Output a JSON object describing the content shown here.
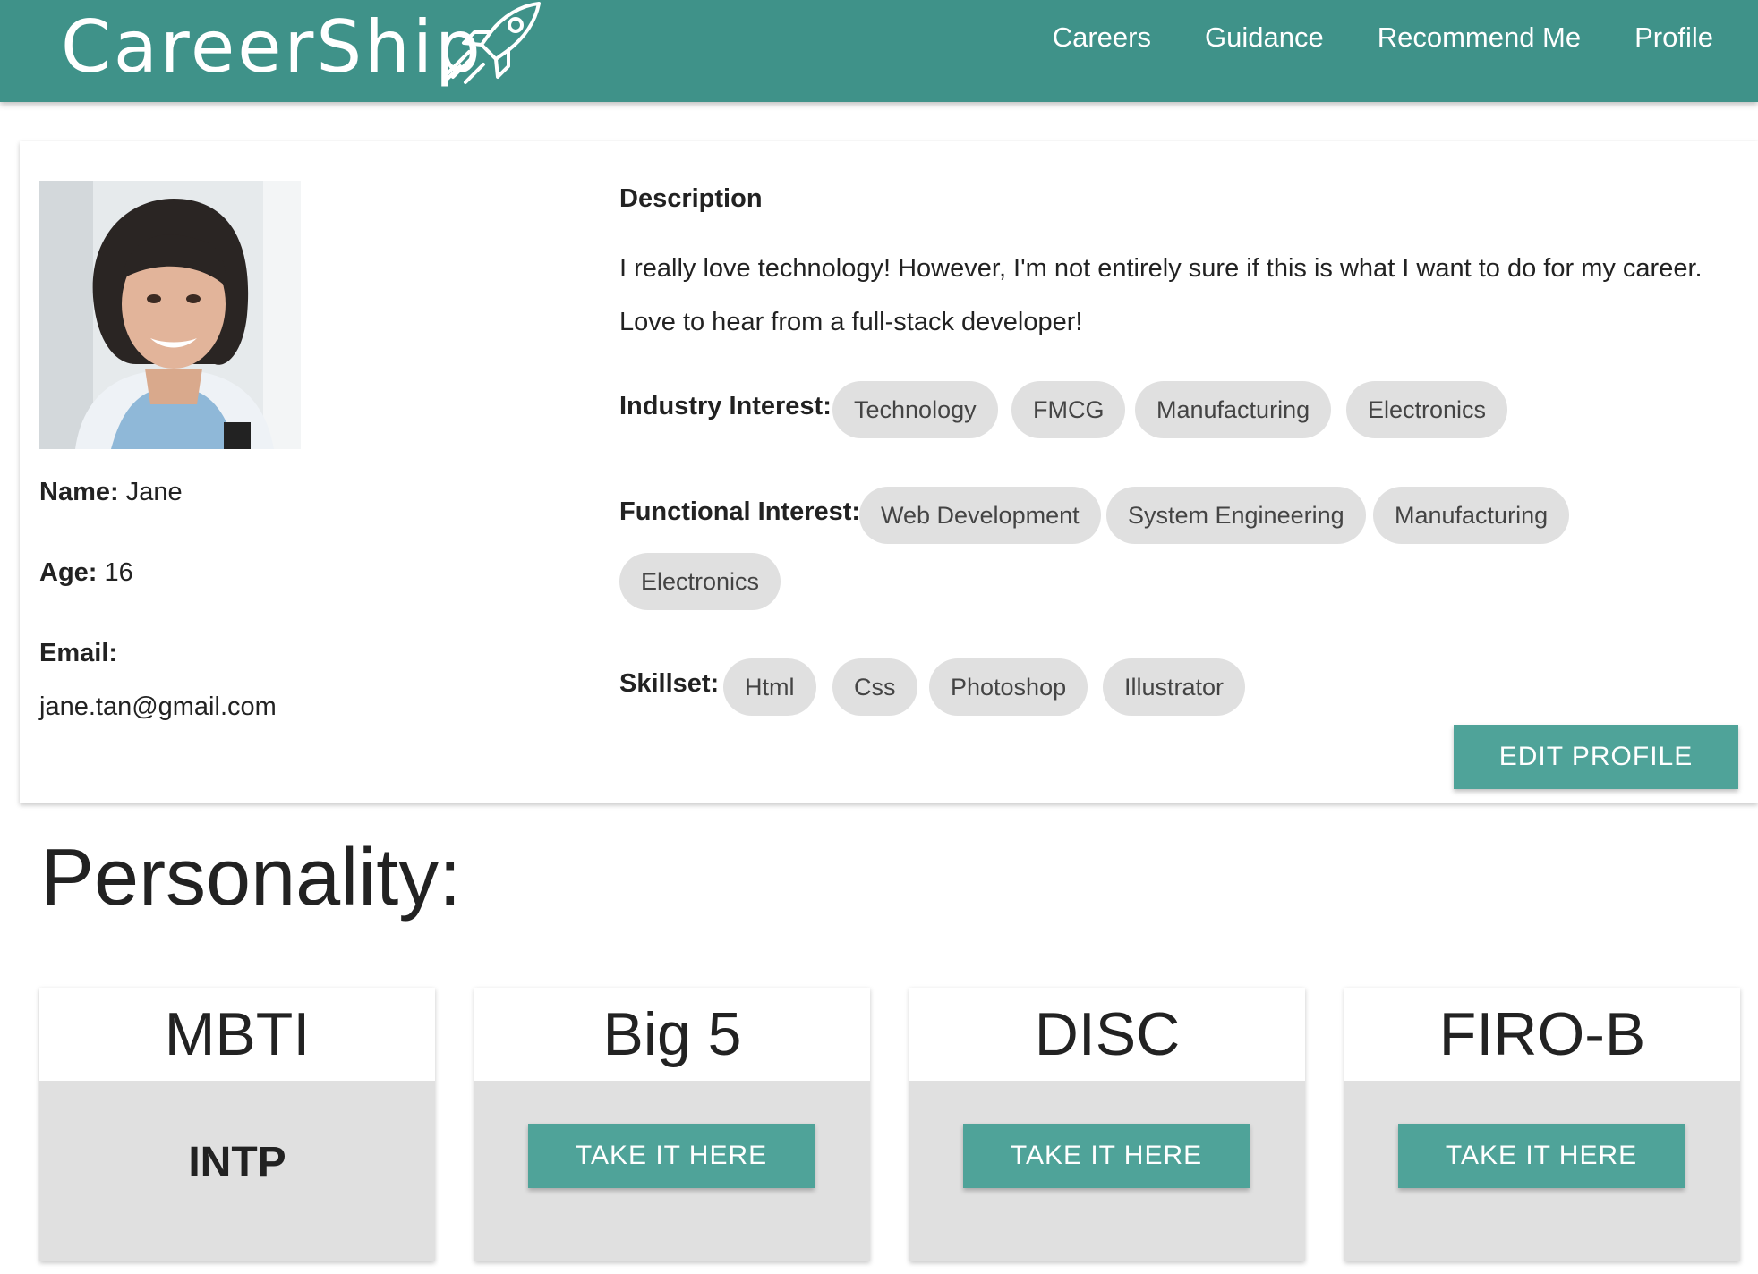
{
  "header": {
    "brand": "CareerShip",
    "nav": [
      "Careers",
      "Guidance",
      "Recommend Me",
      "Profile"
    ]
  },
  "profile": {
    "name_label": "Name:",
    "name": "Jane",
    "age_label": "Age:",
    "age": "16",
    "email_label": "Email:",
    "email": "jane.tan@gmail.com",
    "description_title": "Description",
    "description": "I really love technology! However, I'm not entirely sure if this is what I want to do for my career. Love to hear from a full-stack developer!",
    "industry_label": "Industry Interest:",
    "industry": [
      "Technology",
      "FMCG",
      "Manufacturing",
      "Electronics"
    ],
    "functional_label": "Functional Interest:",
    "functional": [
      "Web Development",
      "System Engineering",
      "Manufacturing",
      "Electronics"
    ],
    "skillset_label": "Skillset:",
    "skillset": [
      "Html",
      "Css",
      "Photoshop",
      "Illustrator"
    ],
    "edit_button": "EDIT PROFILE"
  },
  "personality": {
    "title": "Personality:",
    "tests": [
      {
        "name": "MBTI",
        "result": "INTP"
      },
      {
        "name": "Big 5",
        "action": "TAKE IT HERE"
      },
      {
        "name": "DISC",
        "action": "TAKE IT HERE"
      },
      {
        "name": "FIRO-B",
        "action": "TAKE IT HERE"
      }
    ]
  },
  "colors": {
    "header": "#3f9289",
    "button": "#4fa399",
    "chip": "#e0e0e0"
  }
}
